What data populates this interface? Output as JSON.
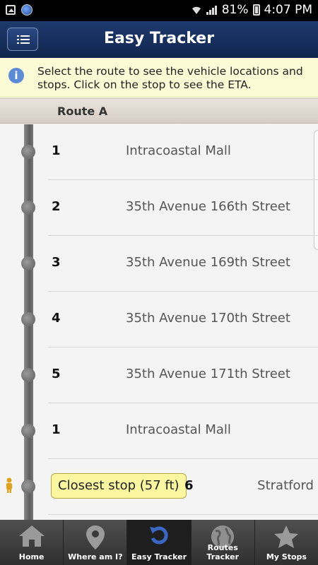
{
  "status_bar": {
    "battery": "81%",
    "time": "4:07 PM"
  },
  "header": {
    "title": "Easy Tracker",
    "menu_icon": "list-icon"
  },
  "info": {
    "icon": "info-icon",
    "text": "Select the route to see the vehicle locations and stops. Click on the stop to see the ETA."
  },
  "route": {
    "name": "Route A"
  },
  "stops": [
    {
      "num": "1",
      "name": "Intracoastal Mall"
    },
    {
      "num": "2",
      "name": "35th Avenue 166th Street"
    },
    {
      "num": "3",
      "name": "35th Avenue 169th Street"
    },
    {
      "num": "4",
      "name": "35th Avenue 170th Street"
    },
    {
      "num": "5",
      "name": "35th Avenue 171th Street"
    },
    {
      "num": "1",
      "name": "Intracoastal Mall"
    }
  ],
  "closest": {
    "label": "Closest stop (57 ft)",
    "num": "6",
    "name": "Stratford"
  },
  "bottom_nav": [
    {
      "label": "Home",
      "icon": "home-icon"
    },
    {
      "label": "Where am I?",
      "icon": "location-pin-icon"
    },
    {
      "label": "Easy Tracker",
      "icon": "refresh-icon"
    },
    {
      "label": "Routes Tracker",
      "icon": "globe-icon"
    },
    {
      "label": "My Stops",
      "icon": "star-icon"
    }
  ],
  "colors": {
    "header": "#1e3a6f",
    "info_bg": "#fbfbd6",
    "closest_bg": "#fbf7a0",
    "tab_active": "#1e1e1e"
  }
}
